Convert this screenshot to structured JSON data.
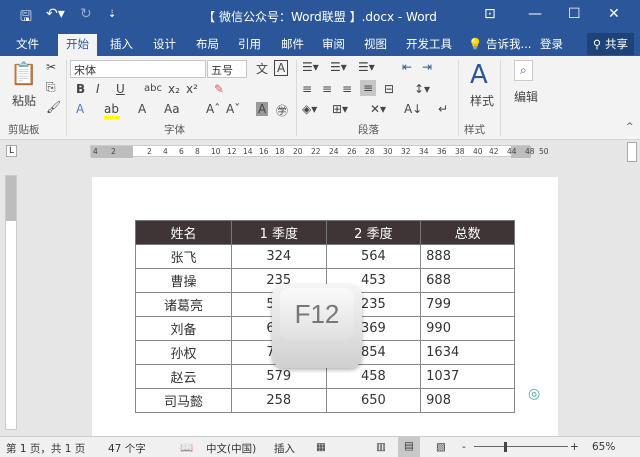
{
  "title": "【 微信公众号：Word联盟 】.docx - Word",
  "tabs": [
    "文件",
    "开始",
    "插入",
    "设计",
    "布局",
    "引用",
    "邮件",
    "审阅",
    "视图",
    "开发工具"
  ],
  "tell_me": "告诉我...",
  "login": "登录",
  "share": "共享",
  "ribbon": {
    "paste": "粘贴",
    "clipboard": "剪贴板",
    "font_name": "宋体",
    "font_size": "五号",
    "font": "字体",
    "paragraph": "段落",
    "styles": "样式",
    "styles_group": "样式",
    "edit": "编辑"
  },
  "ruler": [
    "4",
    "2",
    "2",
    "4",
    "6",
    "8",
    "10",
    "12",
    "14",
    "16",
    "18",
    "20",
    "22",
    "24",
    "26",
    "28",
    "30",
    "32",
    "34",
    "36",
    "38",
    "40",
    "42",
    "44",
    "48",
    "50"
  ],
  "table": {
    "headers": [
      "姓名",
      "1 季度",
      "2 季度",
      "总数"
    ],
    "rows": [
      [
        "张飞",
        "324",
        "564",
        "888"
      ],
      [
        "曹操",
        "235",
        "453",
        "688"
      ],
      [
        "诸葛亮",
        "564",
        "235",
        "799"
      ],
      [
        "刘备",
        "621",
        "369",
        "990"
      ],
      [
        "孙权",
        "780",
        "854",
        "1634"
      ],
      [
        "赵云",
        "579",
        "458",
        "1037"
      ],
      [
        "司马懿",
        "258",
        "650",
        "908"
      ]
    ]
  },
  "overlay_key": "F12",
  "status": {
    "page": "第 1 页，共 1 页",
    "words": "47 个字",
    "lang": "中文(中国)",
    "mode": "插入",
    "zoom": "65%"
  }
}
